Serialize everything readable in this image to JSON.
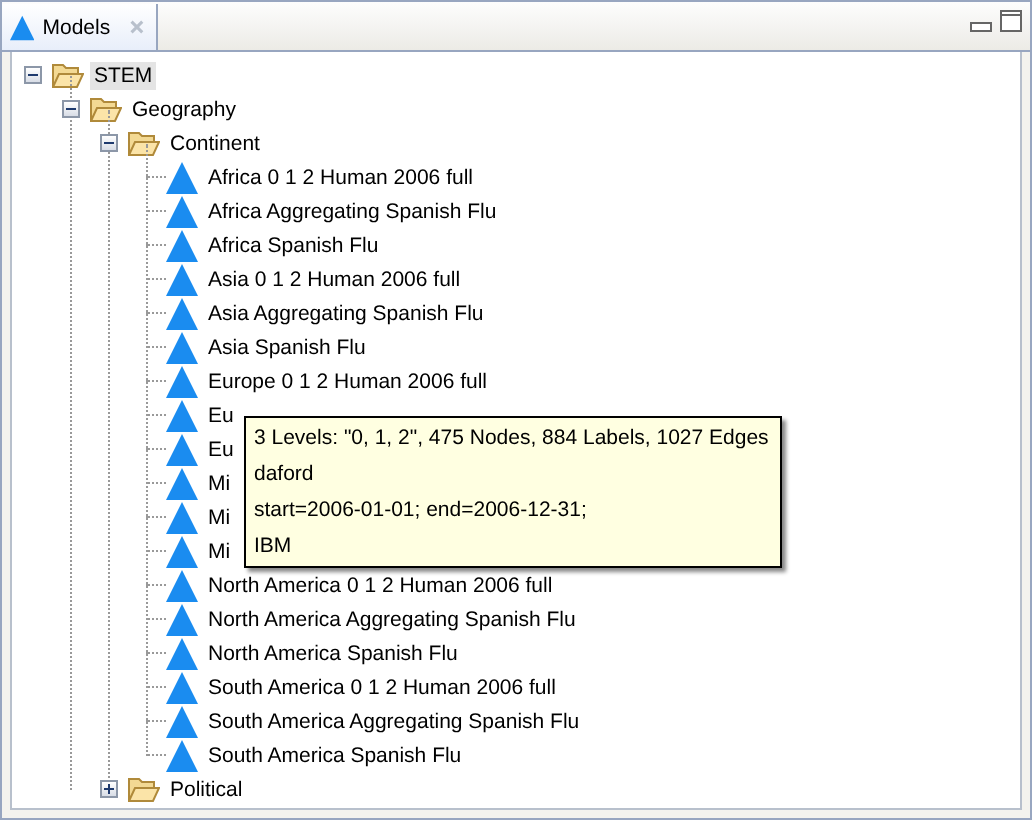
{
  "view_tab": {
    "label": "Models",
    "selected": true
  },
  "tree": [
    {
      "kind": "folder",
      "label": "STEM",
      "expanded": true,
      "selected": true,
      "children": [
        {
          "kind": "folder",
          "label": "Geography",
          "expanded": true,
          "selected": false,
          "children": [
            {
              "kind": "folder",
              "label": "Continent",
              "expanded": true,
              "selected": false,
              "children": [
                {
                  "kind": "model",
                  "label": "Africa 0 1 2 Human 2006 full",
                  "selected": false
                },
                {
                  "kind": "model",
                  "label": "Africa Aggregating Spanish Flu",
                  "selected": false
                },
                {
                  "kind": "model",
                  "label": "Africa Spanish Flu",
                  "selected": false
                },
                {
                  "kind": "model",
                  "label": "Asia 0 1 2 Human 2006 full",
                  "selected": false
                },
                {
                  "kind": "model",
                  "label": "Asia Aggregating Spanish Flu",
                  "selected": false
                },
                {
                  "kind": "model",
                  "label": "Asia Spanish Flu",
                  "selected": false
                },
                {
                  "kind": "model",
                  "label": "Europe 0 1 2 Human 2006 full",
                  "selected": false
                },
                {
                  "kind": "model",
                  "label": "Eu",
                  "selected": false
                },
                {
                  "kind": "model",
                  "label": "Eu",
                  "selected": false
                },
                {
                  "kind": "model",
                  "label": "Mi",
                  "selected": false
                },
                {
                  "kind": "model",
                  "label": "Mi",
                  "selected": false
                },
                {
                  "kind": "model",
                  "label": "Mi",
                  "selected": false
                },
                {
                  "kind": "model",
                  "label": "North America 0 1 2 Human 2006 full",
                  "selected": false
                },
                {
                  "kind": "model",
                  "label": "North America Aggregating Spanish Flu",
                  "selected": false
                },
                {
                  "kind": "model",
                  "label": "North America Spanish Flu",
                  "selected": false
                },
                {
                  "kind": "model",
                  "label": "South America 0 1 2 Human 2006 full",
                  "selected": false
                },
                {
                  "kind": "model",
                  "label": "South America Aggregating Spanish Flu",
                  "selected": false
                },
                {
                  "kind": "model",
                  "label": "South America Spanish Flu",
                  "selected": false
                }
              ]
            },
            {
              "kind": "folder",
              "label": "Political",
              "expanded": false,
              "selected": false
            }
          ]
        }
      ]
    }
  ],
  "tooltip": {
    "lines": [
      "3 Levels: \"0, 1, 2\", 475 Nodes, 884 Labels, 1027 Edges",
      "daford",
      "start=2006-01-01; end=2006-12-31;",
      "IBM"
    ]
  }
}
